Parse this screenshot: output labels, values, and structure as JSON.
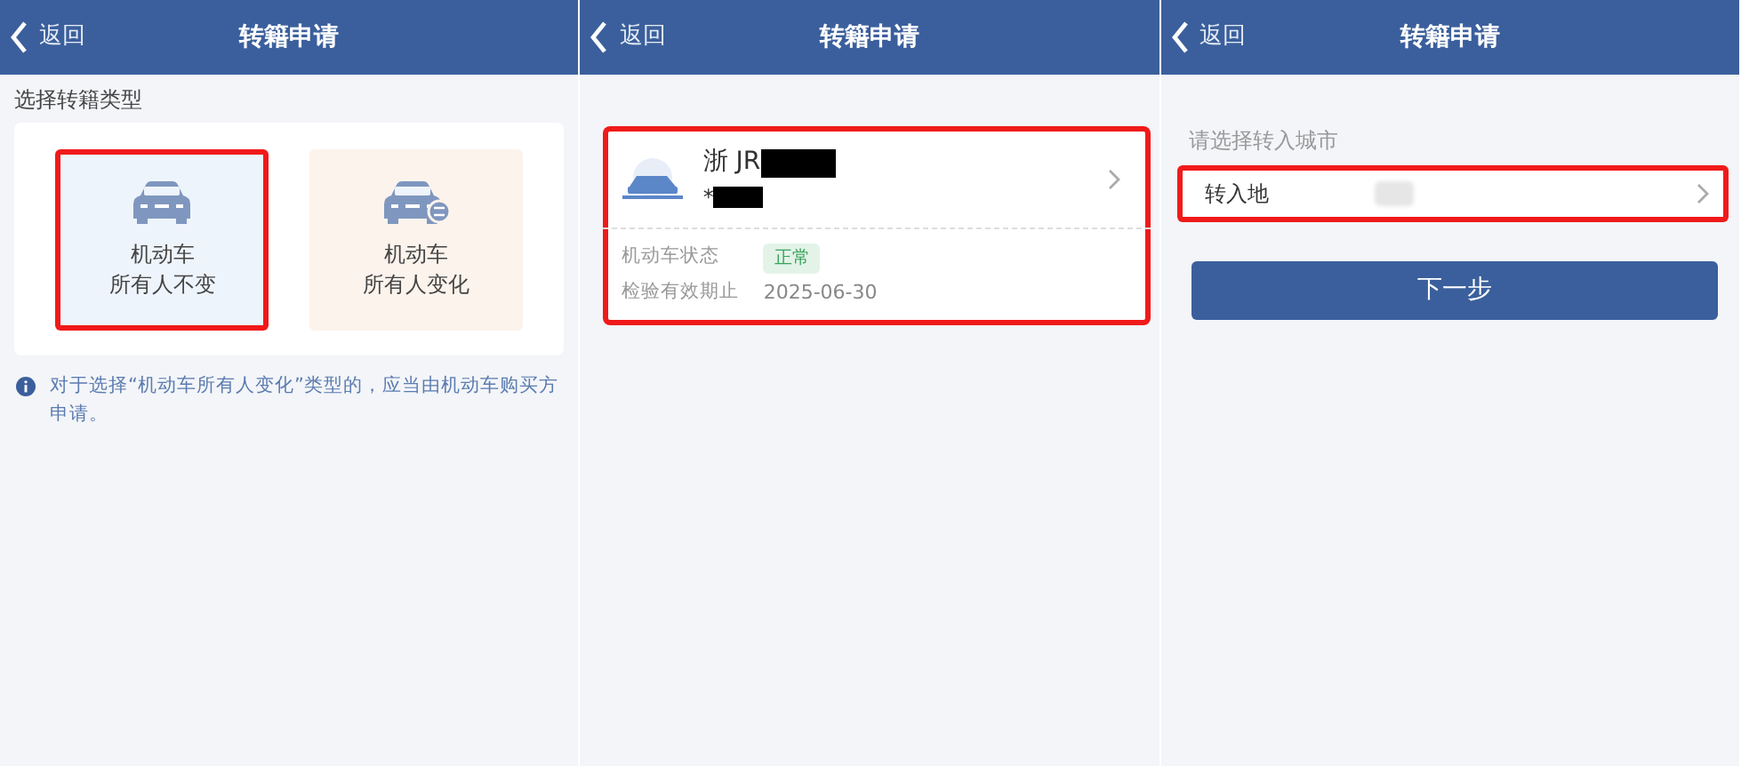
{
  "screens": [
    {
      "kind": "type_select",
      "header": {
        "back": "返回",
        "title": "转籍申请"
      },
      "section_label": "选择转籍类型",
      "options": [
        {
          "line1": "机动车",
          "line2": "所有人不变",
          "selected": true,
          "highlighted": true,
          "kind": "same_owner"
        },
        {
          "line1": "机动车",
          "line2": "所有人变化",
          "selected": false,
          "highlighted": false,
          "kind": "changed_owner"
        }
      ],
      "note": "对于选择“机动车所有人变化”类型的，应当由机动车购买方申请。"
    },
    {
      "kind": "vehicle",
      "header": {
        "back": "返回",
        "title": "转籍申请"
      },
      "vehicle": {
        "plate": "浙 JR",
        "owner": "*",
        "highlighted": true,
        "fields": [
          {
            "label": "机动车状态",
            "value": "正常",
            "kind": "badge"
          },
          {
            "label": "检验有效期止",
            "value": "2025-06-30",
            "kind": "text"
          }
        ]
      }
    },
    {
      "kind": "city",
      "header": {
        "back": "返回",
        "title": "转籍申请"
      },
      "prompt": "请选择转入城市",
      "row": {
        "label": "转入地",
        "highlighted": true
      },
      "button": "下一步"
    }
  ]
}
